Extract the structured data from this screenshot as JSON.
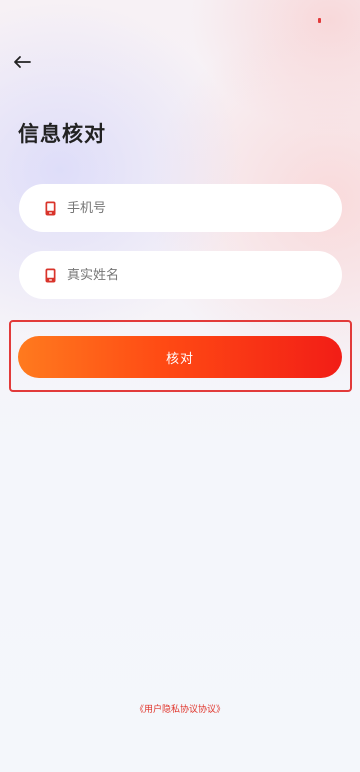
{
  "header": {
    "title": "信息核对"
  },
  "form": {
    "phone_placeholder": "手机号",
    "name_placeholder": "真实姓名"
  },
  "actions": {
    "verify_label": "核对"
  },
  "footer": {
    "agreement_link": "《用户隐私协议协议》"
  },
  "icons": {
    "back": "arrow-left-icon",
    "phone_field": "phone-icon",
    "name_field": "phone-icon"
  },
  "colors": {
    "accent": "#ff4a14",
    "accent_start": "#ff7a1e",
    "accent_end": "#f21d16",
    "highlight_border": "#e23a3a",
    "link": "#e0342a",
    "icon": "#d9342b"
  }
}
